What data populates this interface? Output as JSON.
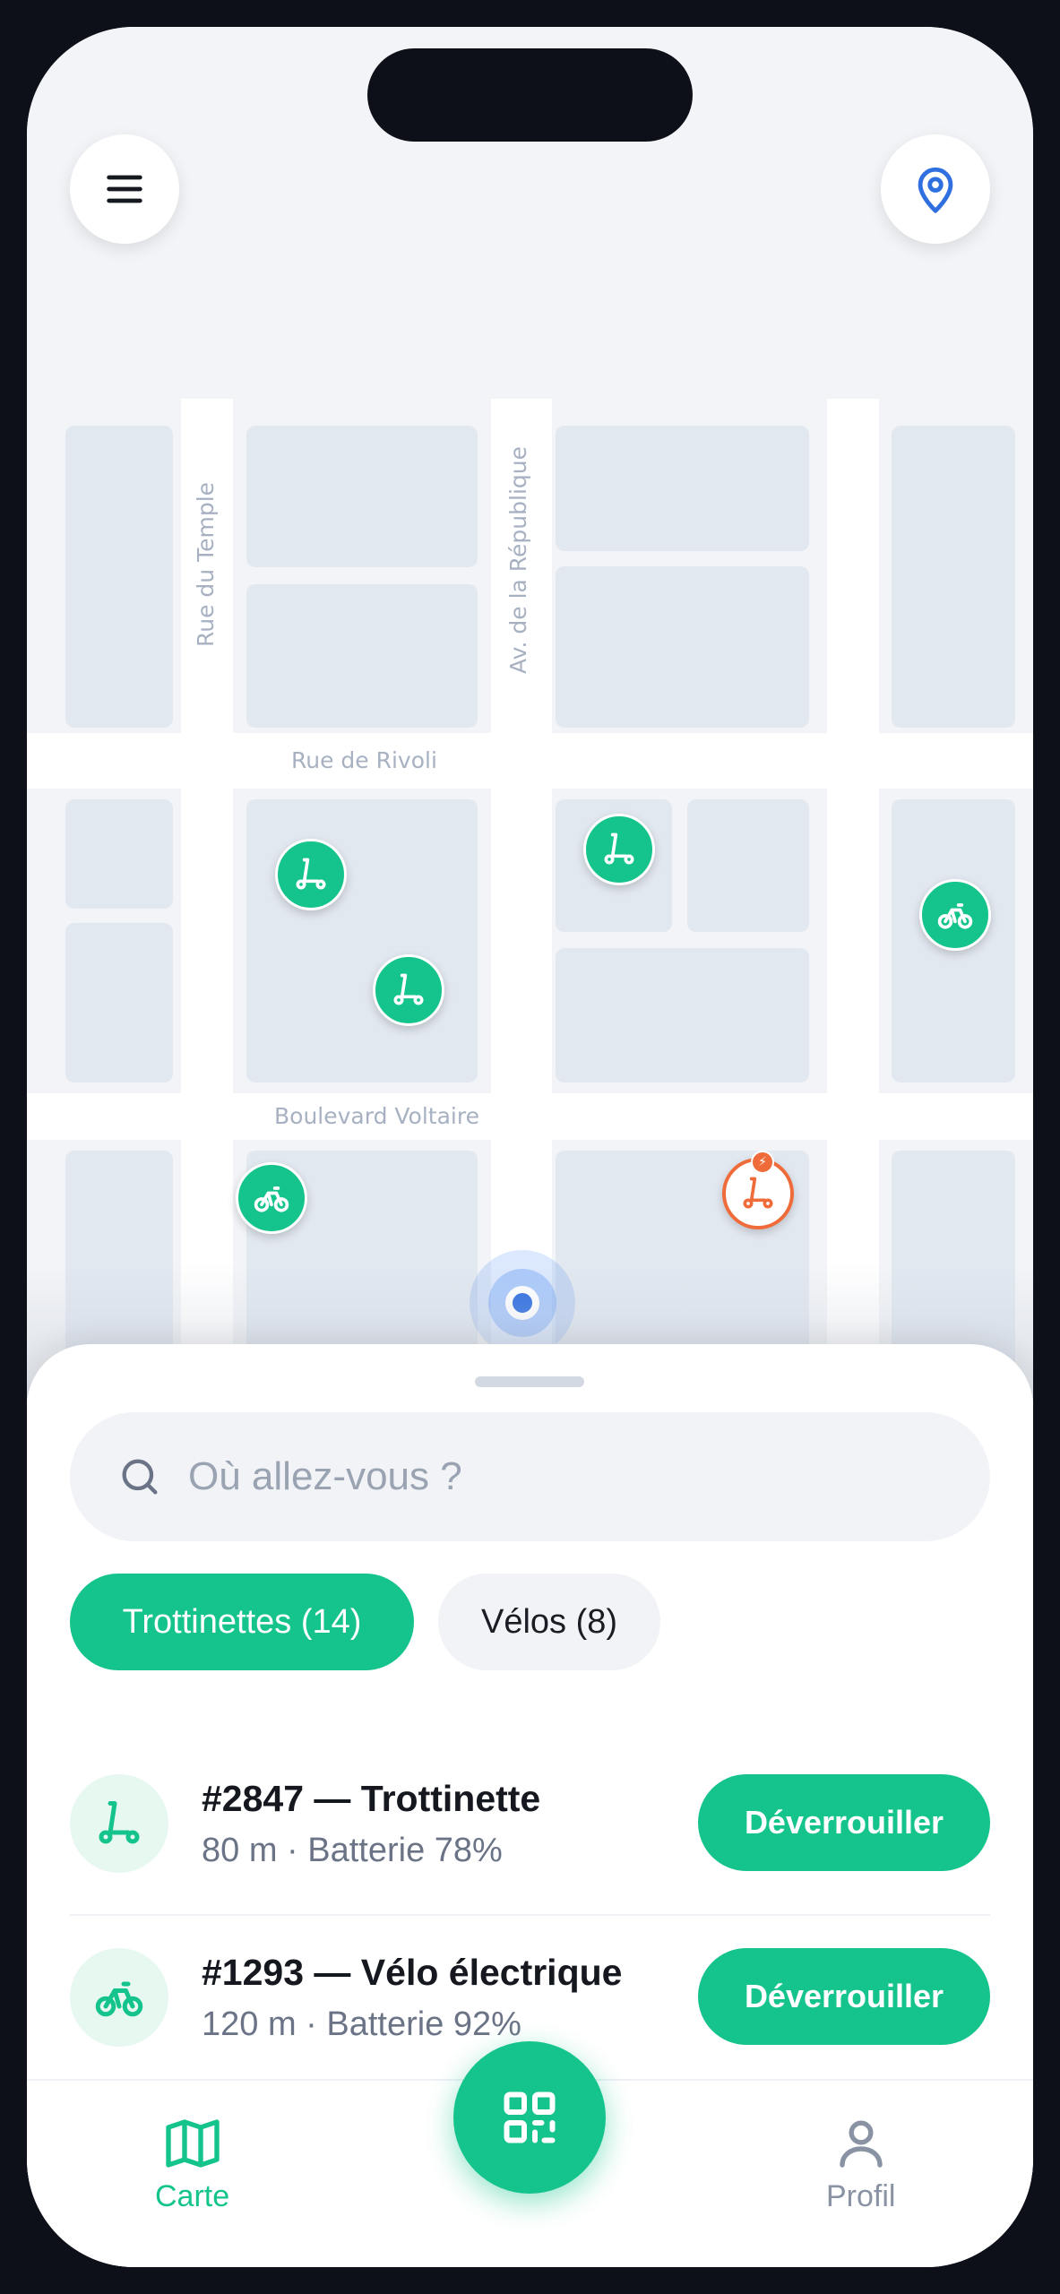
{
  "colors": {
    "accent": "#15c48c",
    "warning": "#ef6b3a",
    "location": "#2f6fe0"
  },
  "map": {
    "streets": {
      "temple": "Rue du Temple",
      "republique": "Av. de la République",
      "rivoli": "Rue de Rivoli",
      "voltaire": "Boulevard Voltaire"
    },
    "markers": [
      {
        "type": "scooter-icon"
      },
      {
        "type": "scooter-icon"
      },
      {
        "type": "scooter-icon"
      },
      {
        "type": "bike-icon"
      },
      {
        "type": "bike-icon"
      },
      {
        "type": "scooter-icon",
        "status": "low-battery"
      }
    ]
  },
  "header": {
    "menu_icon": "menu-icon",
    "locate_icon": "location-pin-icon"
  },
  "search": {
    "placeholder": "Où allez-vous ?"
  },
  "filters": [
    {
      "label": "Trottinettes (14)",
      "active": true
    },
    {
      "label": "Vélos (8)",
      "active": false
    }
  ],
  "vehicles": [
    {
      "title": "#2847 — Trottinette",
      "subtitle": "80 m · Batterie 78%",
      "action": "Déverrouiller",
      "icon": "scooter-icon"
    },
    {
      "title": "#1293 — Vélo électrique",
      "subtitle": "120 m · Batterie 92%",
      "action": "Déverrouiller",
      "icon": "bike-icon"
    }
  ],
  "nav": {
    "map_label": "Carte",
    "scan_icon": "qr-code-icon",
    "profile_label": "Profil"
  }
}
